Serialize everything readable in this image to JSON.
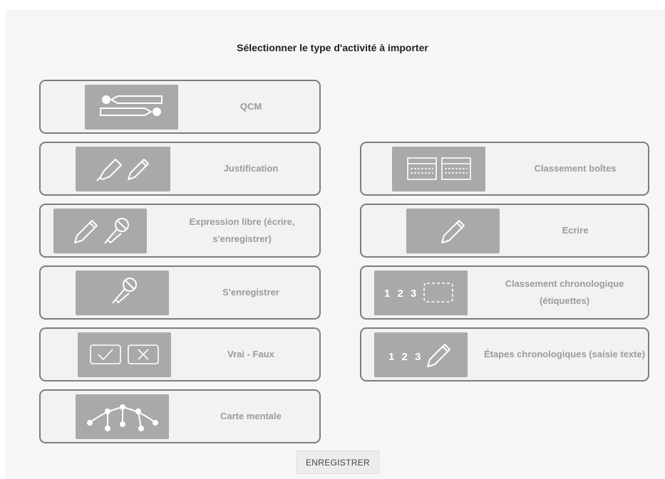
{
  "page": {
    "title": "Sélectionner le type d'activité à importer"
  },
  "activities": [
    {
      "id": "qcm",
      "label": "QCM",
      "icon": "multiple-choice-icon"
    },
    {
      "id": "justification",
      "label": "Justification",
      "icon": "pencil-highlighter-icon"
    },
    {
      "id": "classement-boites",
      "label": "Classement boîtes",
      "icon": "boxes-sort-icon"
    },
    {
      "id": "expression-libre",
      "label": "Expression libre (écrire, s'enregistrer)",
      "icon": "pencil-microphone-icon"
    },
    {
      "id": "ecrire",
      "label": "Ecrire",
      "icon": "pencil-icon"
    },
    {
      "id": "enregistrer",
      "label": "S'enregistrer",
      "icon": "microphone-icon"
    },
    {
      "id": "classement-chrono",
      "label": "Classement chronologique (étiquettes)",
      "icon": "numbered-tags-icon",
      "icon_text": "1 2 3"
    },
    {
      "id": "vrai-faux",
      "label": "Vrai - Faux",
      "icon": "true-false-icon"
    },
    {
      "id": "etapes-chrono",
      "label": "Étapes chronologiques (saisie texte)",
      "icon": "numbered-pencil-icon",
      "icon_text": "1 2 3"
    },
    {
      "id": "carte-mentale",
      "label": "Carte mentale",
      "icon": "mind-map-icon"
    }
  ],
  "footer": {
    "save_label": "ENREGISTRER"
  },
  "colors": {
    "thumb": "#a9a9a9",
    "border": "#7d7d7d",
    "label": "#9b9b9b"
  }
}
